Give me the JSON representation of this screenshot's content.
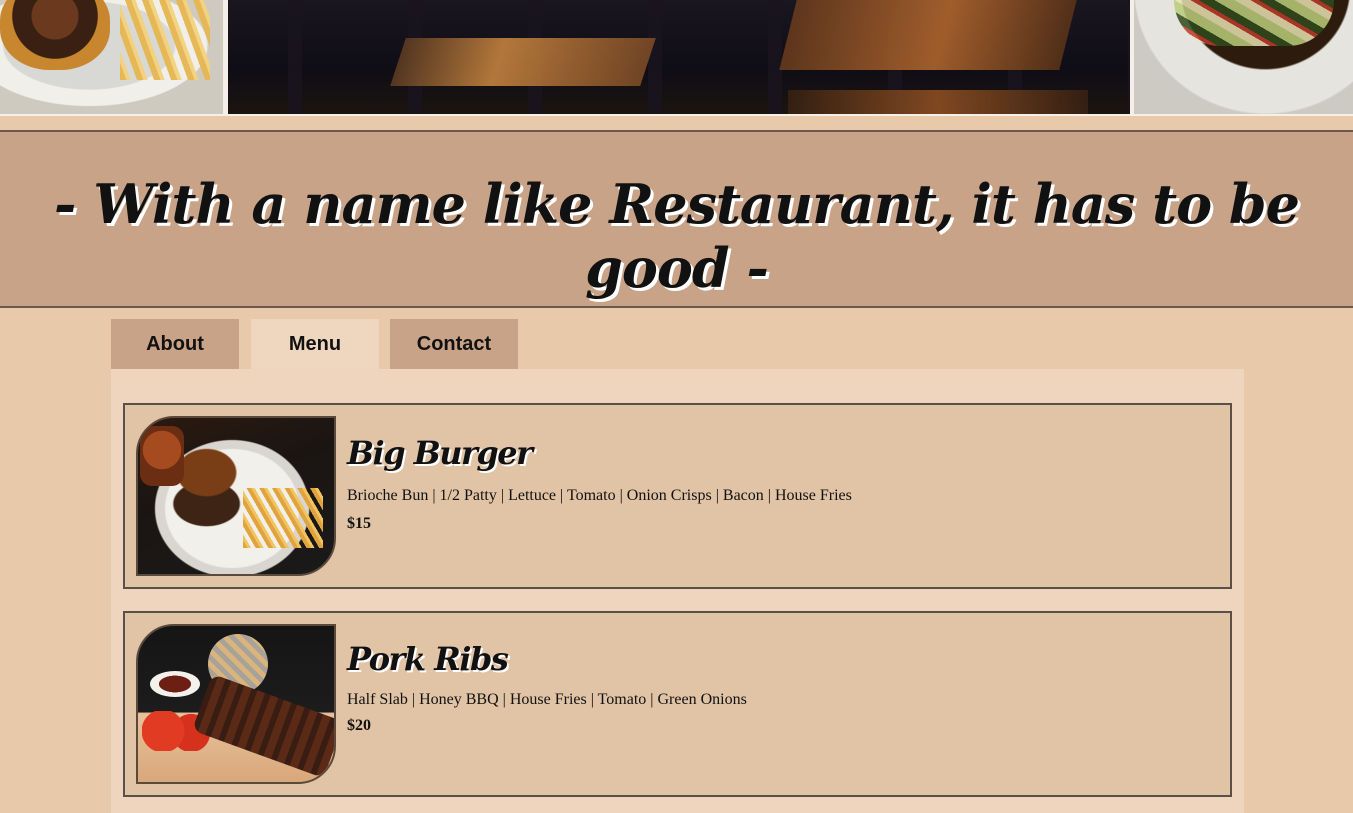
{
  "hero": {
    "images": [
      "burger-photo",
      "dining-room-photo",
      "salad-photo"
    ]
  },
  "banner": {
    "tagline": "- With a name like Restaurant, it has to be good -"
  },
  "tabs": [
    {
      "label": "About",
      "active": false
    },
    {
      "label": "Menu",
      "active": true
    },
    {
      "label": "Contact",
      "active": false
    }
  ],
  "menu": {
    "items": [
      {
        "name": "Big Burger",
        "description": "Brioche Bun | 1/2 Patty | Lettuce | Tomato | Onion Crisps | Bacon | House Fries",
        "price": "$15",
        "image": "burger-photo"
      },
      {
        "name": "Pork Ribs",
        "description": "Half Slab | Honey BBQ | House Fries | Tomato | Green Onions",
        "price": "$20",
        "image": "ribs-photo"
      }
    ]
  },
  "colors": {
    "page_background": "#e8c9aa",
    "banner_background": "#c9a388",
    "active_tab": "#efd6bf",
    "panel_background": "#efd5be",
    "card_background": "#e1c3a5",
    "border": "#5b5048"
  }
}
